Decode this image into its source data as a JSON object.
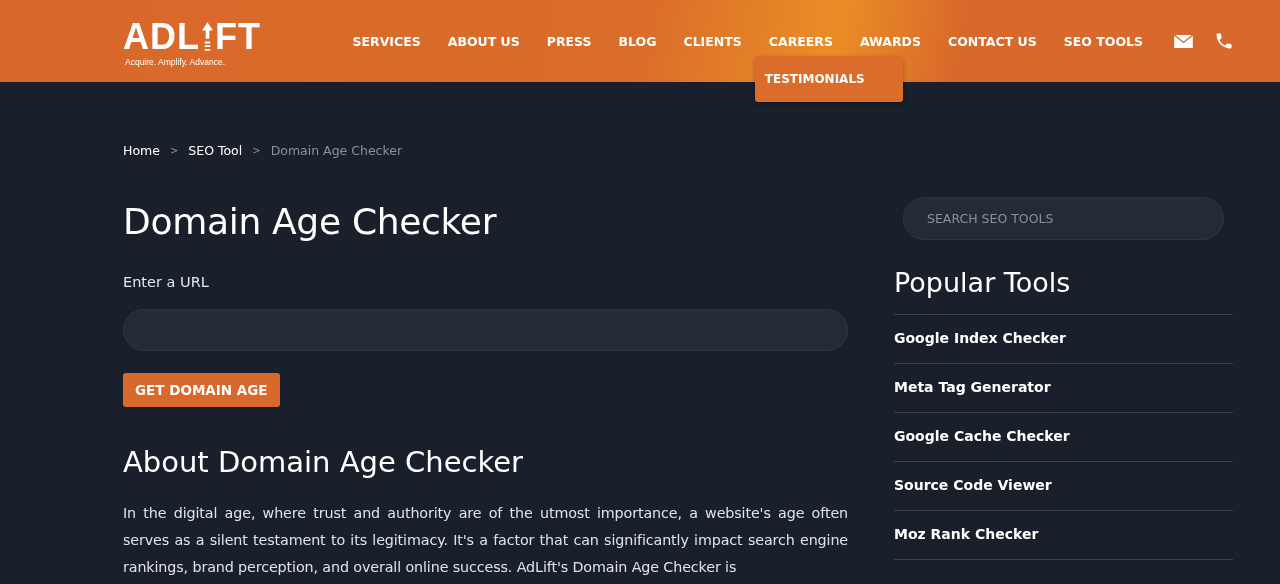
{
  "logo": {
    "left": "ADL",
    "right": "FT",
    "tagline": "Acquire. Amplify. Advance."
  },
  "nav": [
    {
      "label": "SERVICES"
    },
    {
      "label": "ABOUT US"
    },
    {
      "label": "PRESS"
    },
    {
      "label": "BLOG"
    },
    {
      "label": "CLIENTS"
    },
    {
      "label": "CAREERS",
      "submenu": [
        "TESTIMONIALS"
      ]
    },
    {
      "label": "AWARDS"
    },
    {
      "label": "CONTACT US"
    },
    {
      "label": "SEO TOOLS"
    }
  ],
  "breadcrumb": [
    {
      "label": "Home",
      "current": false
    },
    {
      "label": "SEO Tool",
      "current": false
    },
    {
      "label": "Domain Age Checker",
      "current": true
    }
  ],
  "breadcrumb_separator": ">",
  "title": "Domain Age Checker",
  "url_label": "Enter a URL",
  "submit_button": "GET DOMAIN AGE",
  "about_heading": "About Domain Age Checker",
  "about_text": "In the digital age, where trust and authority are of the utmost importance, a website's age often serves as a silent testament to its legitimacy. It's a factor that can significantly impact search engine rankings, brand perception, and overall online success. AdLift's Domain Age Checker is",
  "sidebar": {
    "search_placeholder": "SEARCH SEO TOOLS",
    "heading": "Popular Tools",
    "tools": [
      "Google Index Checker",
      "Meta Tag Generator",
      "Google Cache Checker",
      "Source Code Viewer",
      "Moz Rank Checker"
    ]
  }
}
